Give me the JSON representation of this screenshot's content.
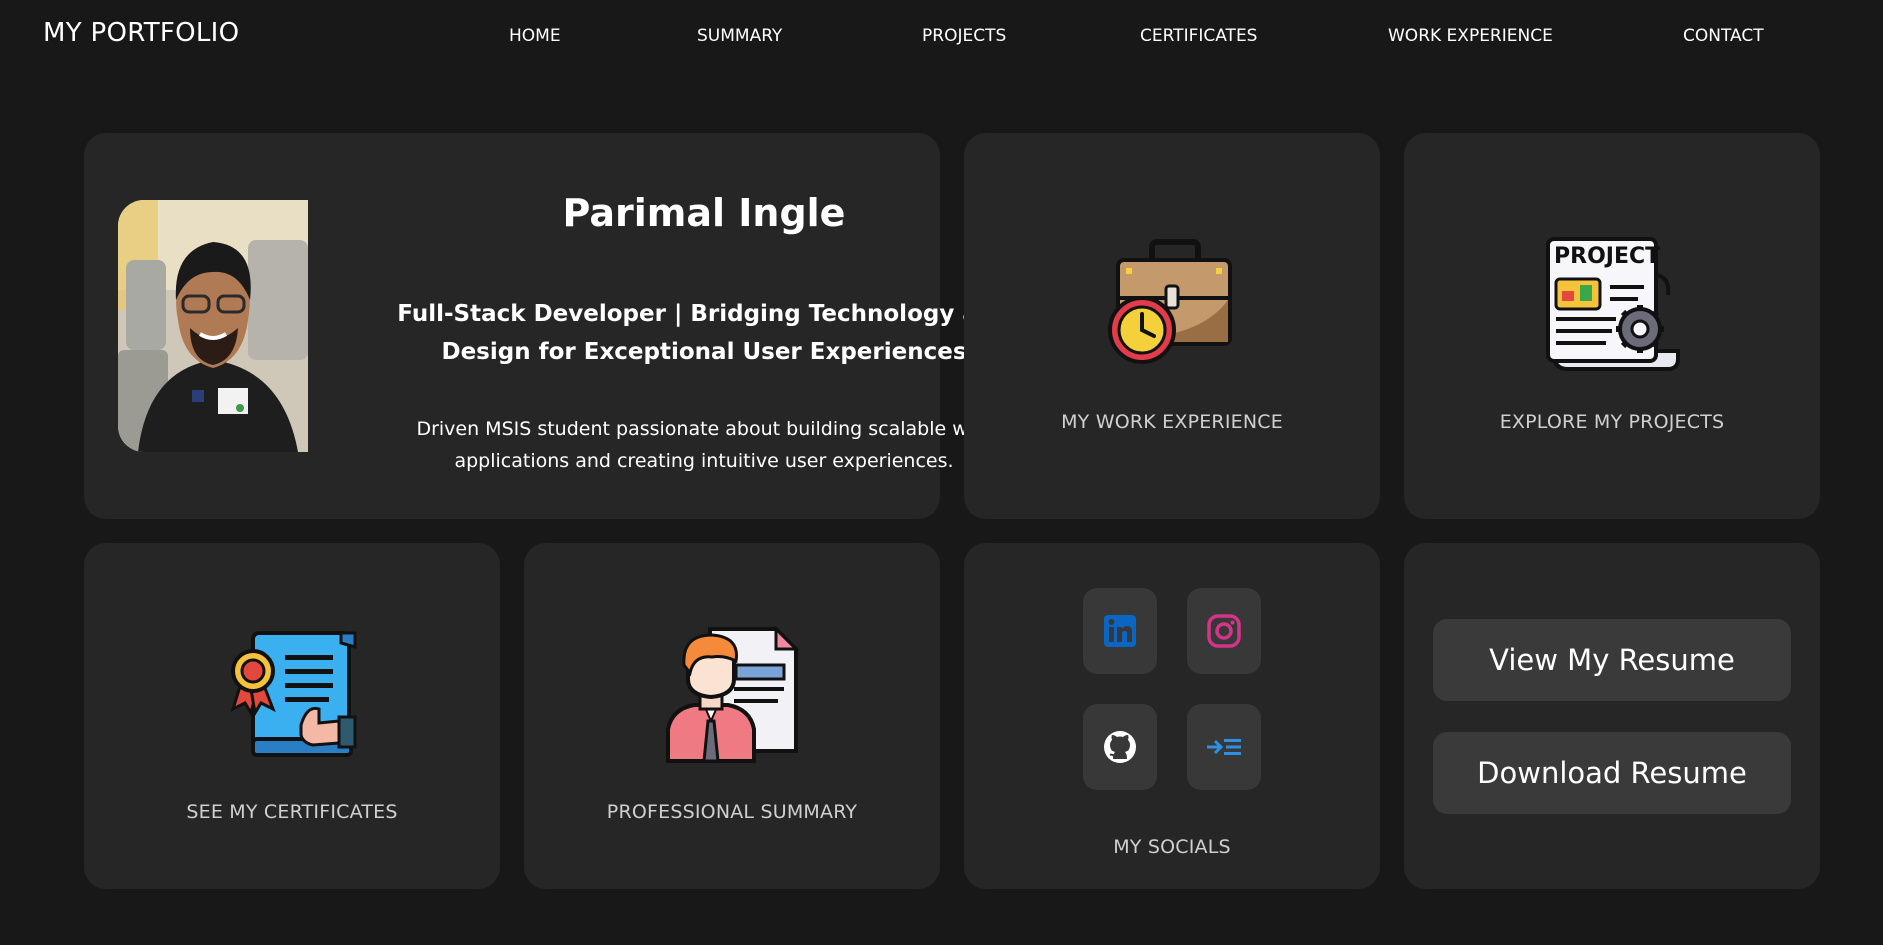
{
  "brand": "MY PORTFOLIO",
  "nav": {
    "home": "HOME",
    "summary": "SUMMARY",
    "projects": "PROJECTS",
    "certificates": "CERTIFICATES",
    "work_experience": "WORK EXPERIENCE",
    "contact": "CONTACT"
  },
  "profile": {
    "name": "Parimal Ingle",
    "headline_line1": "Full-Stack Developer | Bridging Technology and",
    "headline_line2": "Design for Exceptional User Experiences",
    "desc_line1": "Driven MSIS student passionate about building scalable web",
    "desc_line2": "applications and creating intuitive user experiences."
  },
  "cards": {
    "work_experience": "MY WORK EXPERIENCE",
    "projects": "EXPLORE MY PROJECTS",
    "certificates": "SEE MY CERTIFICATES",
    "summary": "PROFESSIONAL SUMMARY",
    "socials": "MY SOCIALS",
    "project_icon_text": "PROJECT"
  },
  "socials": {
    "items": [
      {
        "icon": "linkedin-icon",
        "color": "#0a66c2"
      },
      {
        "icon": "instagram-icon",
        "color": "#d6338a"
      },
      {
        "icon": "github-icon",
        "color": "#ffffff"
      },
      {
        "icon": "link-arrow-icon",
        "color": "#2f8fe0"
      }
    ]
  },
  "resume": {
    "view_label": "View My Resume",
    "download_label": "Download Resume"
  },
  "colors": {
    "background": "#181818",
    "card": "#262626",
    "button": "#3a3a3a"
  }
}
